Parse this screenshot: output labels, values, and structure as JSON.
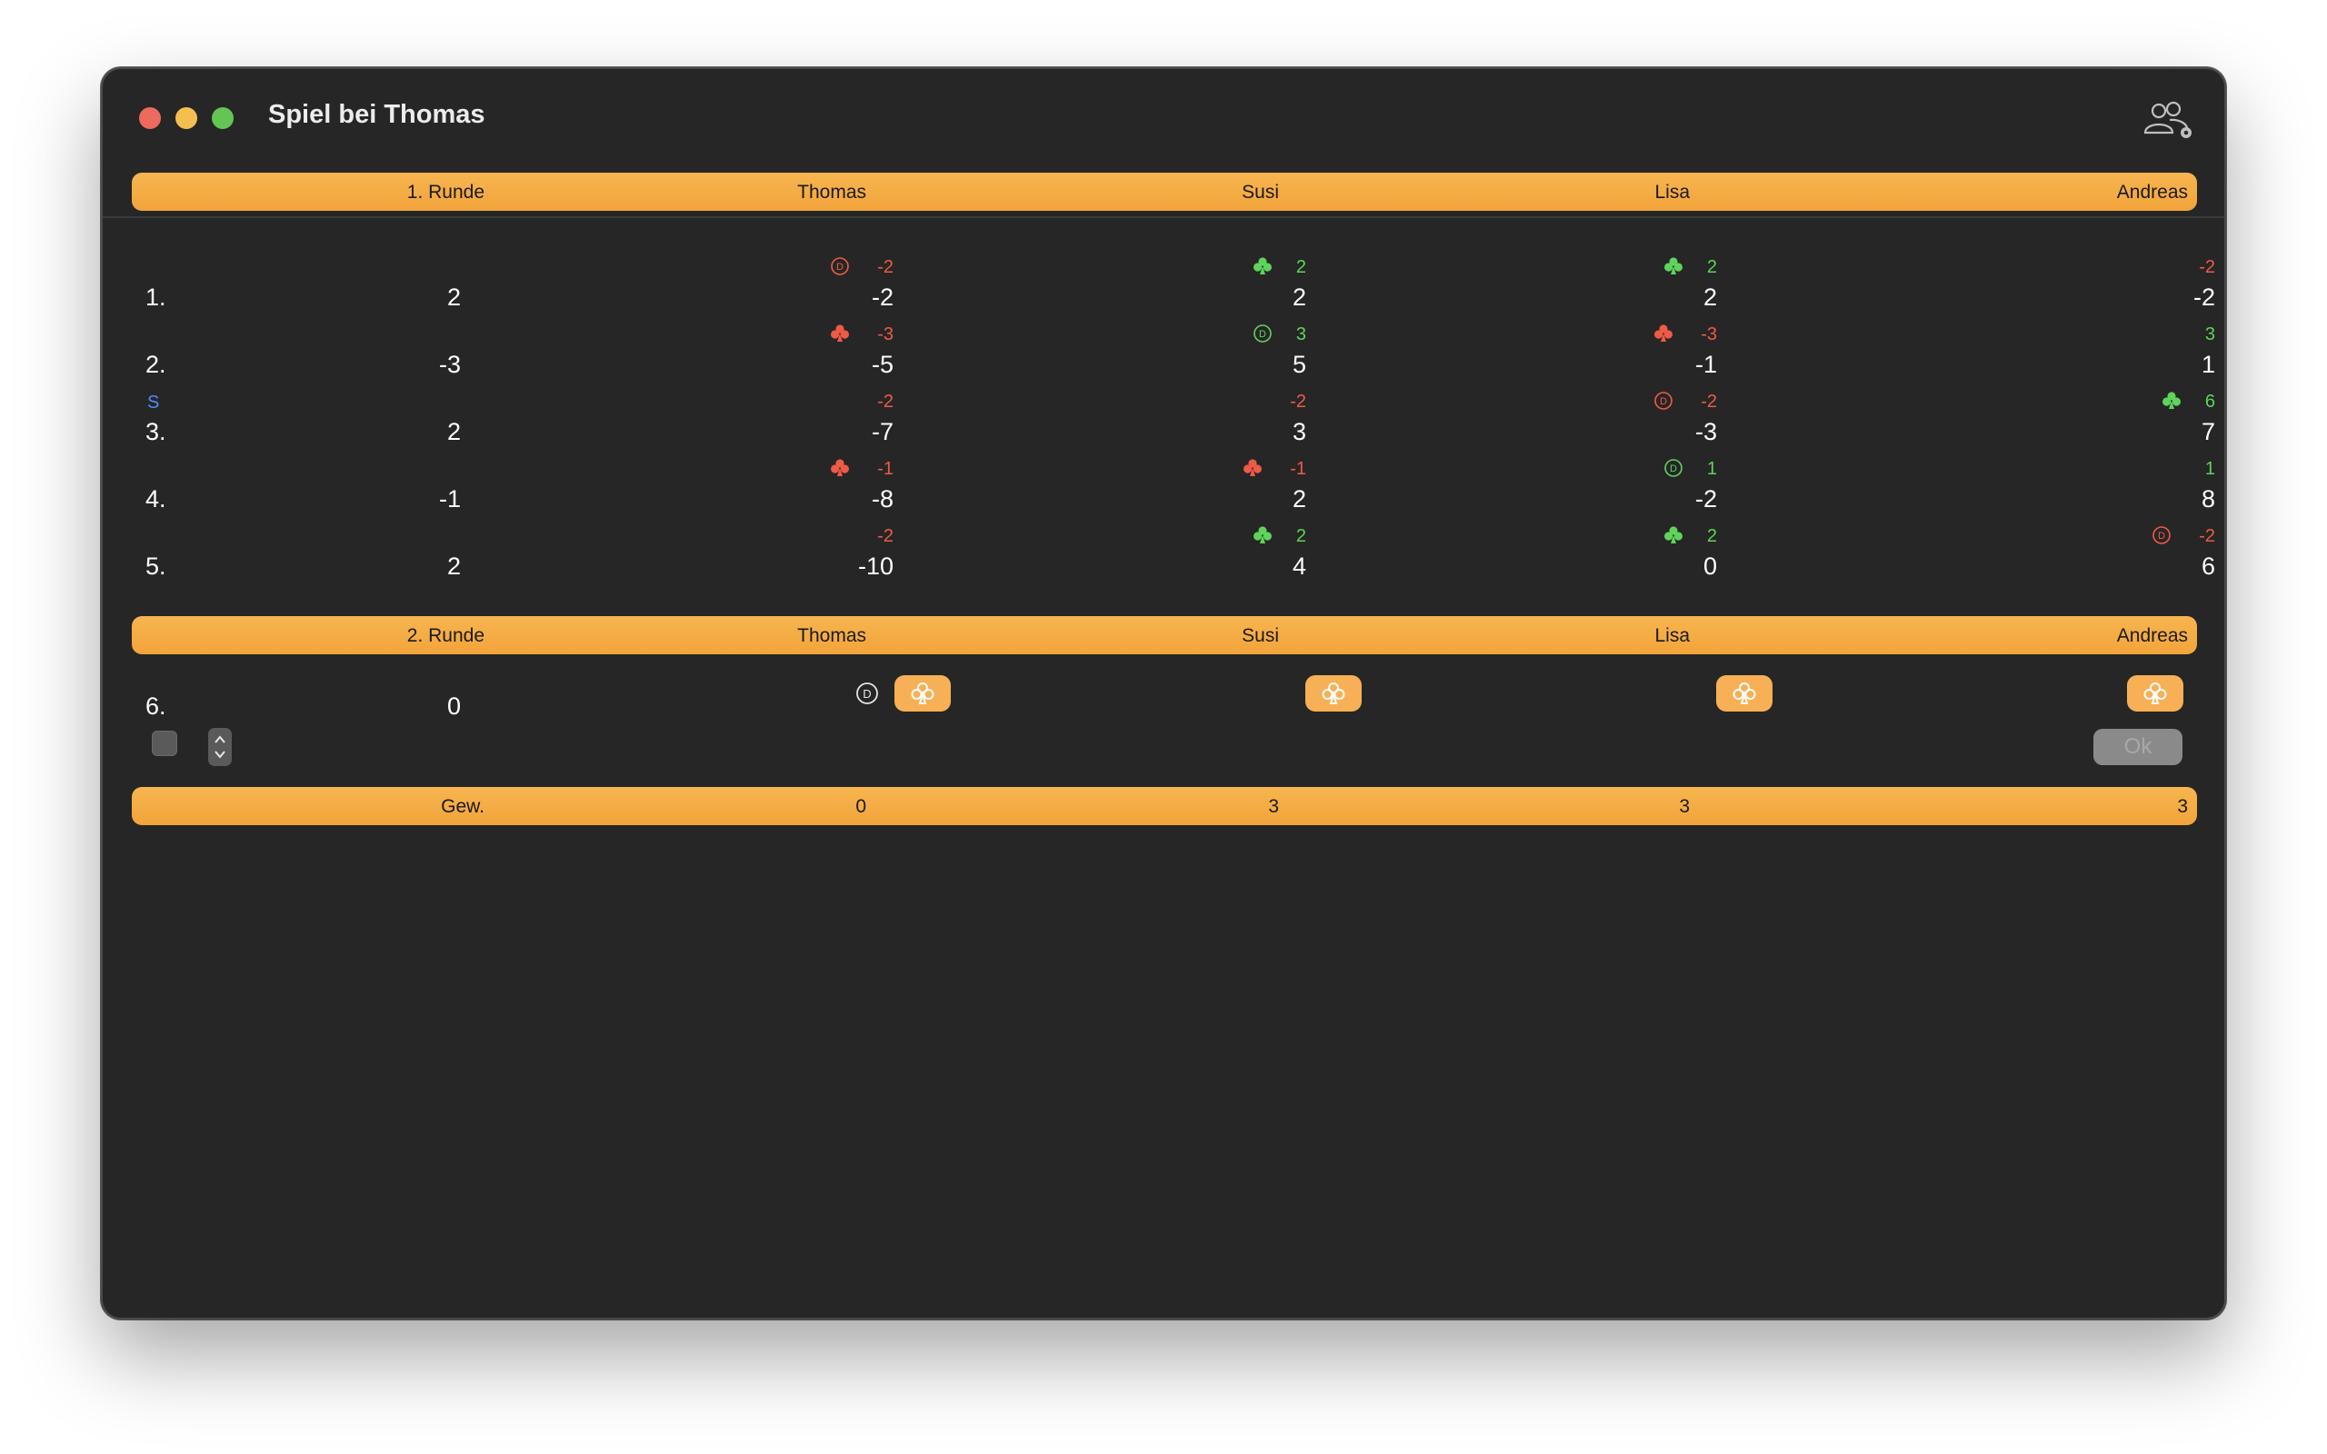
{
  "window": {
    "title": "Spiel bei Thomas"
  },
  "round1": {
    "header": {
      "round_label": "1. Runde",
      "players": [
        "Thomas",
        "Susi",
        "Lisa",
        "Andreas"
      ]
    },
    "rows": [
      {
        "index": "1.",
        "marker": "",
        "value": "2",
        "cells": [
          {
            "delta": "-2",
            "sign": "neg",
            "icon": "dealer-icon",
            "total": "-2"
          },
          {
            "delta": "2",
            "sign": "pos",
            "icon": "club-icon",
            "total": "2"
          },
          {
            "delta": "2",
            "sign": "pos",
            "icon": "club-icon",
            "total": "2"
          },
          {
            "delta": "-2",
            "sign": "neg",
            "icon": "",
            "total": "-2"
          }
        ]
      },
      {
        "index": "2.",
        "marker": "",
        "value": "-3",
        "cells": [
          {
            "delta": "-3",
            "sign": "neg",
            "icon": "club-icon",
            "total": "-5"
          },
          {
            "delta": "3",
            "sign": "pos",
            "icon": "dealer-icon",
            "total": "5"
          },
          {
            "delta": "-3",
            "sign": "neg",
            "icon": "club-icon",
            "total": "-1"
          },
          {
            "delta": "3",
            "sign": "pos",
            "icon": "",
            "total": "1"
          }
        ]
      },
      {
        "index": "3.",
        "marker": "S",
        "value": "2",
        "cells": [
          {
            "delta": "-2",
            "sign": "neg",
            "icon": "",
            "total": "-7"
          },
          {
            "delta": "-2",
            "sign": "neg",
            "icon": "",
            "total": "3"
          },
          {
            "delta": "-2",
            "sign": "neg",
            "icon": "dealer-icon",
            "total": "-3"
          },
          {
            "delta": "6",
            "sign": "pos",
            "icon": "club-icon",
            "total": "7"
          }
        ]
      },
      {
        "index": "4.",
        "marker": "",
        "value": "-1",
        "cells": [
          {
            "delta": "-1",
            "sign": "neg",
            "icon": "club-icon",
            "total": "-8"
          },
          {
            "delta": "-1",
            "sign": "neg",
            "icon": "club-icon",
            "total": "2"
          },
          {
            "delta": "1",
            "sign": "pos",
            "icon": "dealer-icon",
            "total": "-2"
          },
          {
            "delta": "1",
            "sign": "pos",
            "icon": "",
            "total": "8"
          }
        ]
      },
      {
        "index": "5.",
        "marker": "",
        "value": "2",
        "cells": [
          {
            "delta": "-2",
            "sign": "neg",
            "icon": "",
            "total": "-10"
          },
          {
            "delta": "2",
            "sign": "pos",
            "icon": "club-icon",
            "total": "4"
          },
          {
            "delta": "2",
            "sign": "pos",
            "icon": "club-icon",
            "total": "0"
          },
          {
            "delta": "-2",
            "sign": "neg",
            "icon": "dealer-icon",
            "total": "6"
          }
        ]
      }
    ]
  },
  "round2": {
    "header": {
      "round_label": "2. Runde",
      "players": [
        "Thomas",
        "Susi",
        "Lisa",
        "Andreas"
      ]
    },
    "current_row": {
      "index": "6.",
      "value": "0"
    },
    "ok_label": "Ok"
  },
  "footer": {
    "label": "Gew.",
    "values": [
      "0",
      "3",
      "3",
      "3"
    ]
  },
  "colors": {
    "accent": "#f5a843",
    "negative": "#ef5a46",
    "positive": "#5fd35c",
    "marker": "#4d8cf5"
  }
}
